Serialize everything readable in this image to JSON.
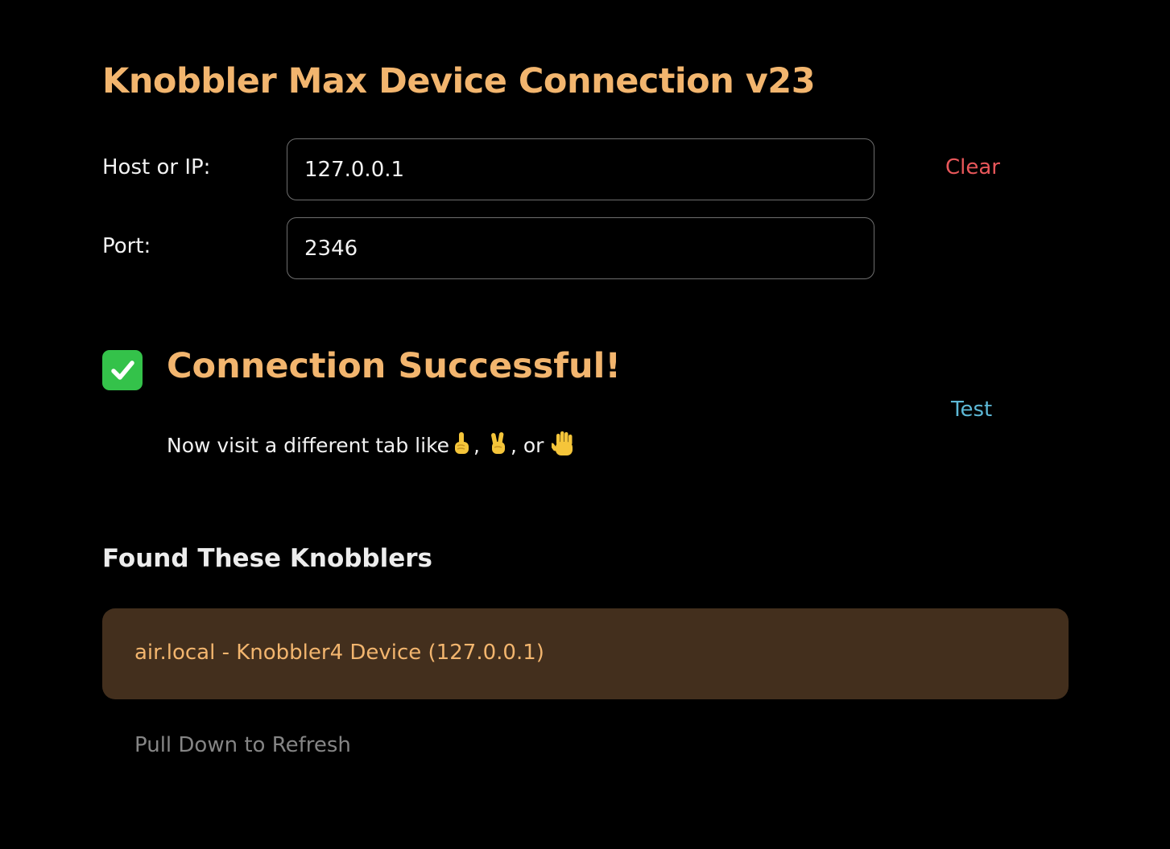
{
  "header": {
    "title": "Knobbler Max Device Connection v23"
  },
  "form": {
    "host_label": "Host or IP:",
    "host_value": "127.0.0.1",
    "port_label": "Port:",
    "port_value": "2346",
    "clear_label": "Clear"
  },
  "status": {
    "icon": "check-mark-icon",
    "title": "Connection Successful!",
    "hint_text": "Now visit a different tab like",
    "hint_sep_1": ",",
    "hint_sep_2": ", or",
    "test_label": "Test"
  },
  "found": {
    "title": "Found These Knobblers",
    "devices": [
      {
        "label": "air.local - Knobbler4 Device (127.0.0.1)"
      }
    ],
    "refresh_hint": "Pull Down to Refresh"
  },
  "colors": {
    "accent": "#F2B56E",
    "clear": "#E8575A",
    "test": "#5DB8D6",
    "success": "#34C24A",
    "device_bg": "#432F1D",
    "muted": "#858585"
  }
}
